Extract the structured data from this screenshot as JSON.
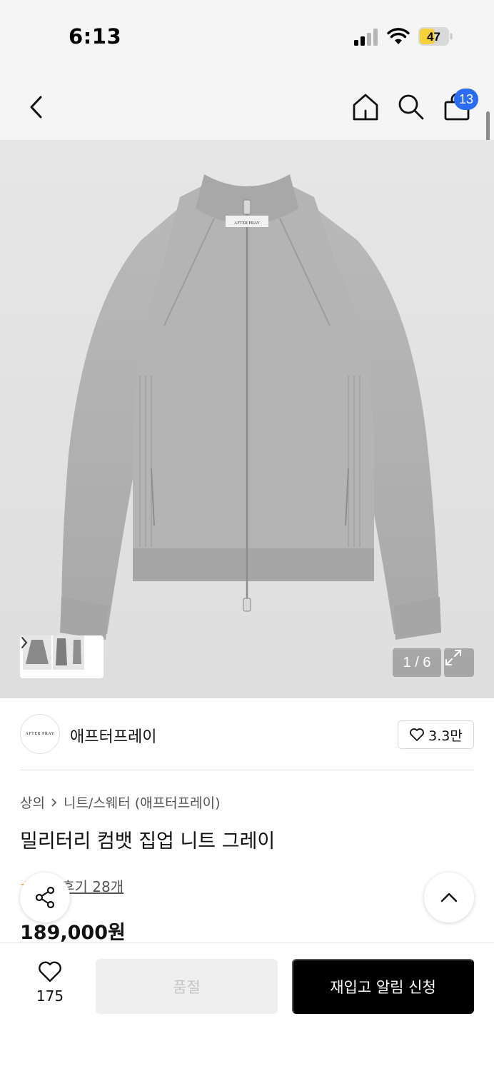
{
  "status_bar": {
    "time": "6:13",
    "battery_level": "47",
    "battery_color": "#f6d23a",
    "icons": [
      "cellular-signal-icon",
      "wifi-icon",
      "battery-icon"
    ]
  },
  "nav": {
    "icons": [
      "back-chevron-icon",
      "home-icon",
      "search-icon",
      "shopping-bag-icon"
    ],
    "cart_count": "13",
    "badge_color": "#2a6df4"
  },
  "gallery": {
    "page_counter": "1 / 6",
    "current_page": 1,
    "total_pages": 6,
    "product_tag_text": "AFTER PRAY"
  },
  "brand": {
    "logo_text": "AFTER PRAY",
    "name": "애프터프레이",
    "likes": "3.3만"
  },
  "breadcrumb": {
    "category": "상의",
    "subcategory": "니트/스웨터 (애프터프레이)"
  },
  "product": {
    "title": "밀리터리 컴뱃 집업 니트 그레이",
    "review_link": "후기 28개",
    "price": "189,000원"
  },
  "bottom_bar": {
    "wish_count": "175",
    "soldout_label": "품절",
    "restock_label": "재입고 알림 신청"
  }
}
